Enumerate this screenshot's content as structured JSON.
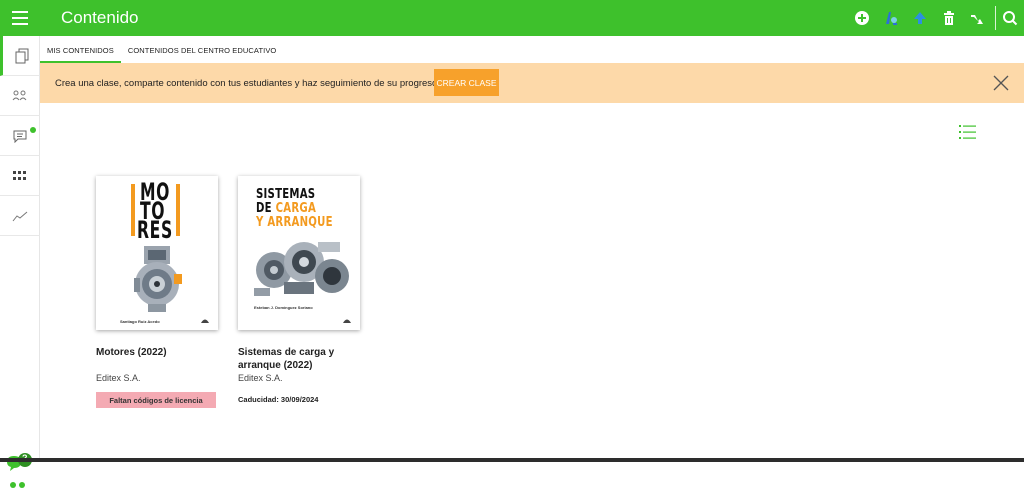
{
  "header": {
    "title": "Contenido",
    "menu_icon": "hamburger-icon",
    "tools": [
      "add-icon",
      "assign-icon",
      "upload-icon",
      "delete-icon",
      "share-icon",
      "search-icon"
    ]
  },
  "sidebar": {
    "items": [
      {
        "icon": "book-copy-icon",
        "active": true
      },
      {
        "icon": "users-icon"
      },
      {
        "icon": "chat-icon",
        "notification": true
      },
      {
        "icon": "apps-grid-icon"
      },
      {
        "icon": "stats-chart-icon"
      }
    ],
    "help_badge": "?"
  },
  "tabs": [
    {
      "label": "MIS CONTENIDOS",
      "active": true
    },
    {
      "label": "CONTENIDOS DEL CENTRO EDUCATIVO",
      "active": false
    }
  ],
  "banner": {
    "text": "Crea una clase, comparte contenido con tus estudiantes y haz seguimiento de su progreso.",
    "button_label": "CREAR CLASE"
  },
  "books": [
    {
      "title": "Motores (2022)",
      "publisher": "Editex S.A.",
      "status": "Faltan códigos de licencia",
      "cover": {
        "lines": [
          "MO",
          "TO",
          "RES"
        ],
        "author_line": "Santiago Ruiz Acedo"
      }
    },
    {
      "title": "Sistemas de carga y arranque (2022)",
      "publisher": "Editex S.A.",
      "expiry": "Caducidad: 30/09/2024",
      "cover": {
        "line1": "SISTEMAS",
        "line2_a": "DE ",
        "line2_b": "CARGA",
        "line3": "Y ARRANQUE",
        "author_line": "Esteban J. Domínguez Soriano"
      }
    }
  ],
  "colors": {
    "brand_green": "#3ec12c",
    "banner_bg": "#fdd9a9",
    "button_orange": "#f7a12b",
    "license_badge": "#f4aab3"
  }
}
